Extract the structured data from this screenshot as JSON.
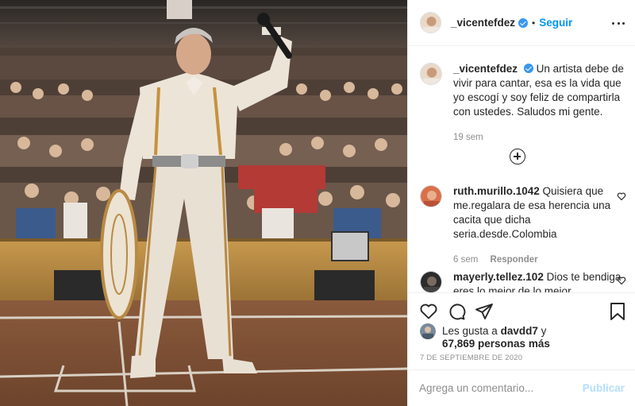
{
  "post": {
    "author": {
      "username": "_vicentefdez",
      "verified": true,
      "avatar_icon": "profile-photo-avatar"
    },
    "follow_label": "Seguir",
    "separator": "•",
    "more_icon": "more-options-icon",
    "caption": {
      "username": "_vicentefdez",
      "text": "Un artista debe de vivir para cantar, esa es la vida que yo escogí y soy feliz de compartirla con ustedes. Saludos mi gente.",
      "age": "19 sem"
    },
    "load_more_icon": "plus-circle-icon",
    "comments": [
      {
        "username": "ruth.murillo.1042",
        "text": "Quisiera que me.regalara de esa herencia una cacita que dicha seria.desde.Colombia",
        "age": "6 sem",
        "reply_label": "Responder"
      },
      {
        "username": "mayerly.tellez.102",
        "text": "Dios te bendiga eres lo mejor de lo mejor",
        "age": "",
        "reply_label": ""
      }
    ],
    "actions": {
      "like_icon": "heart-icon",
      "comment_icon": "comment-icon",
      "share_icon": "paper-plane-icon",
      "save_icon": "bookmark-icon"
    },
    "likes": {
      "prefix": "Les gusta a",
      "first_user": "davdd7",
      "joiner": "y",
      "others": "67,869 personas más"
    },
    "date": "7 DE SEPTIEMBRE DE 2020",
    "comment_input": {
      "placeholder": "Agrega un comentario...",
      "value": ""
    },
    "publish_label": "Publicar",
    "colors": {
      "accent": "#0095f6",
      "publish_disabled": "#b2dffc",
      "muted_text": "#8e8e8e",
      "verified_badge": "#3897f0"
    }
  }
}
